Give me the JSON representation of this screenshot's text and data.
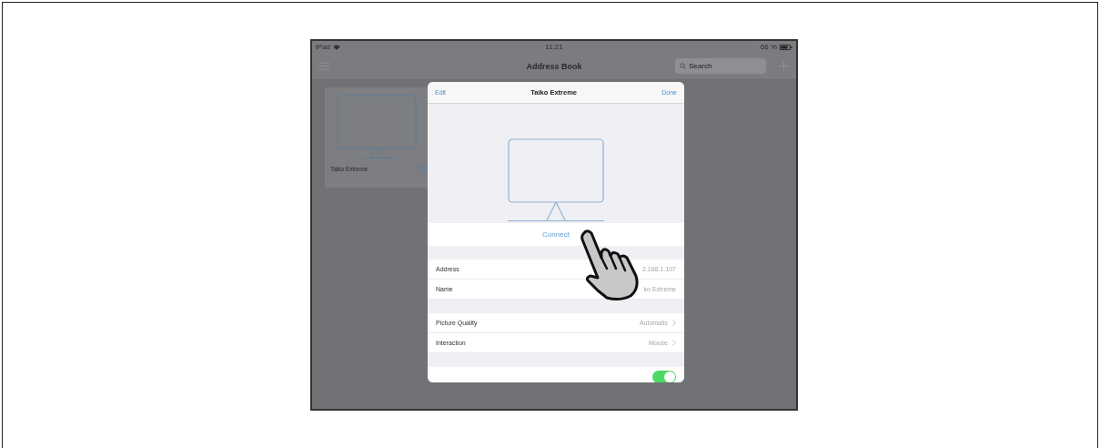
{
  "status_bar": {
    "device": "iPad",
    "time": "11:21",
    "battery": "66 %"
  },
  "nav_bar": {
    "title": "Address Book",
    "search": {
      "placeholder": "Search"
    }
  },
  "devices": [
    {
      "name": "Taiko Extreme"
    }
  ],
  "dialog": {
    "left_button": "Edit",
    "title": "Taiko Extreme",
    "right_button": "Done",
    "action": "Connect",
    "sections": [
      {
        "rows": [
          {
            "kind": "value",
            "label": "Address",
            "value": "2.168.1.107"
          },
          {
            "kind": "value",
            "label": "Name",
            "value": "ko Extreme"
          }
        ]
      },
      {
        "rows": [
          {
            "kind": "link",
            "label": "Picture Quality",
            "value": "Automatic"
          },
          {
            "kind": "link",
            "label": "Interaction",
            "value": "Mouse"
          }
        ]
      },
      {
        "rows": [
          {
            "kind": "toggle",
            "on": true
          }
        ]
      }
    ]
  }
}
